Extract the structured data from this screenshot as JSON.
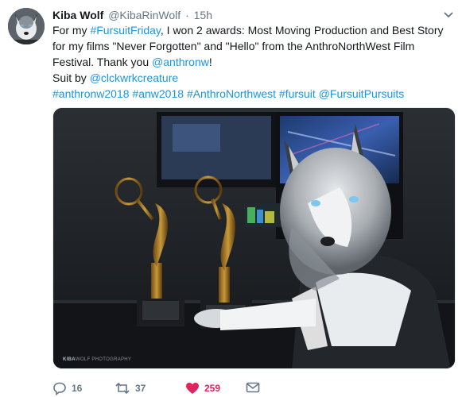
{
  "tweet": {
    "display_name": "Kiba Wolf",
    "handle": "@KibaRinWolf",
    "separator": "·",
    "time": "15h",
    "text": {
      "l1_a": "For my ",
      "l1_link": "#FursuitFriday",
      "l1_b": ", I won 2 awards: Most Moving Production and Best Story",
      "l2": "for my films \"Never Forgotten\" and \"Hello\" from the AnthroNorthWest Film",
      "l3_a": "Festival. Thank you ",
      "l3_link": "@anthronw",
      "l3_b": "!",
      "l4_a": "Suit by ",
      "l4_link": "@clckwrkcreature",
      "hashtags": [
        "#anthronw2018",
        "#anw2018",
        "#AnthroNorthwest",
        "#fursuit",
        "@FursuitPursuits"
      ]
    },
    "media": {
      "watermark_bold": "KIBA",
      "watermark_rest": "WOLF PHOTOGRAPHY"
    },
    "actions": {
      "replies": "16",
      "retweets": "37",
      "likes": "259"
    }
  },
  "colors": {
    "link": "#1b95e0",
    "muted": "#657786",
    "like": "#e0245e"
  },
  "icons": [
    "avatar-wolf",
    "chevron-down-icon",
    "reply-icon",
    "retweet-icon",
    "heart-icon",
    "mail-icon"
  ]
}
